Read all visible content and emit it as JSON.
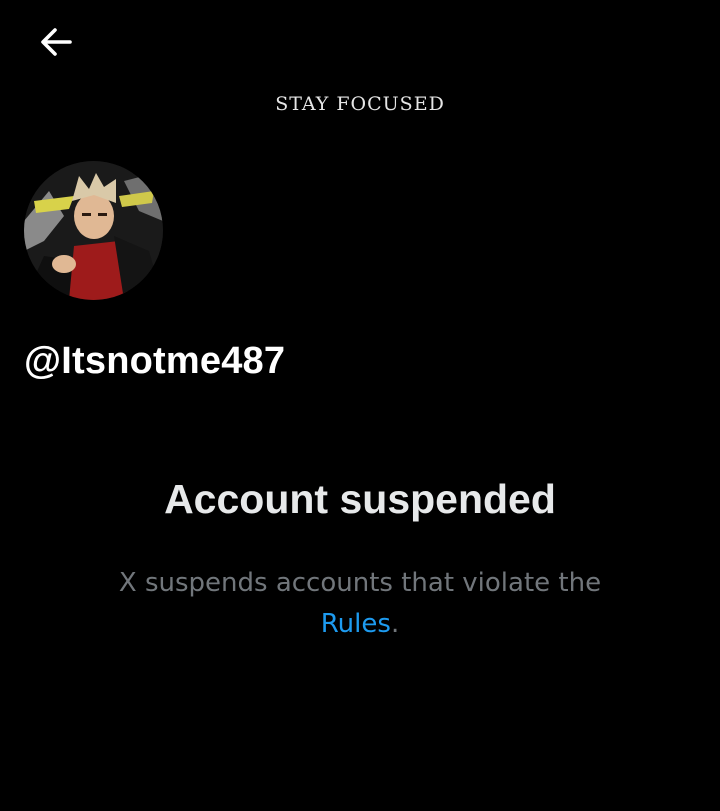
{
  "header": {
    "back_icon": "arrow-left-icon"
  },
  "banner": {
    "text": "STAY FOCUSED"
  },
  "profile": {
    "handle": "@Itsnotme487"
  },
  "suspension": {
    "title": "Account suspended",
    "description": "X suspends accounts that violate the",
    "rules_link": "Rules",
    "trailing": ".",
    "colors": {
      "muted": "#71767b",
      "link": "#1d9bf0"
    }
  }
}
